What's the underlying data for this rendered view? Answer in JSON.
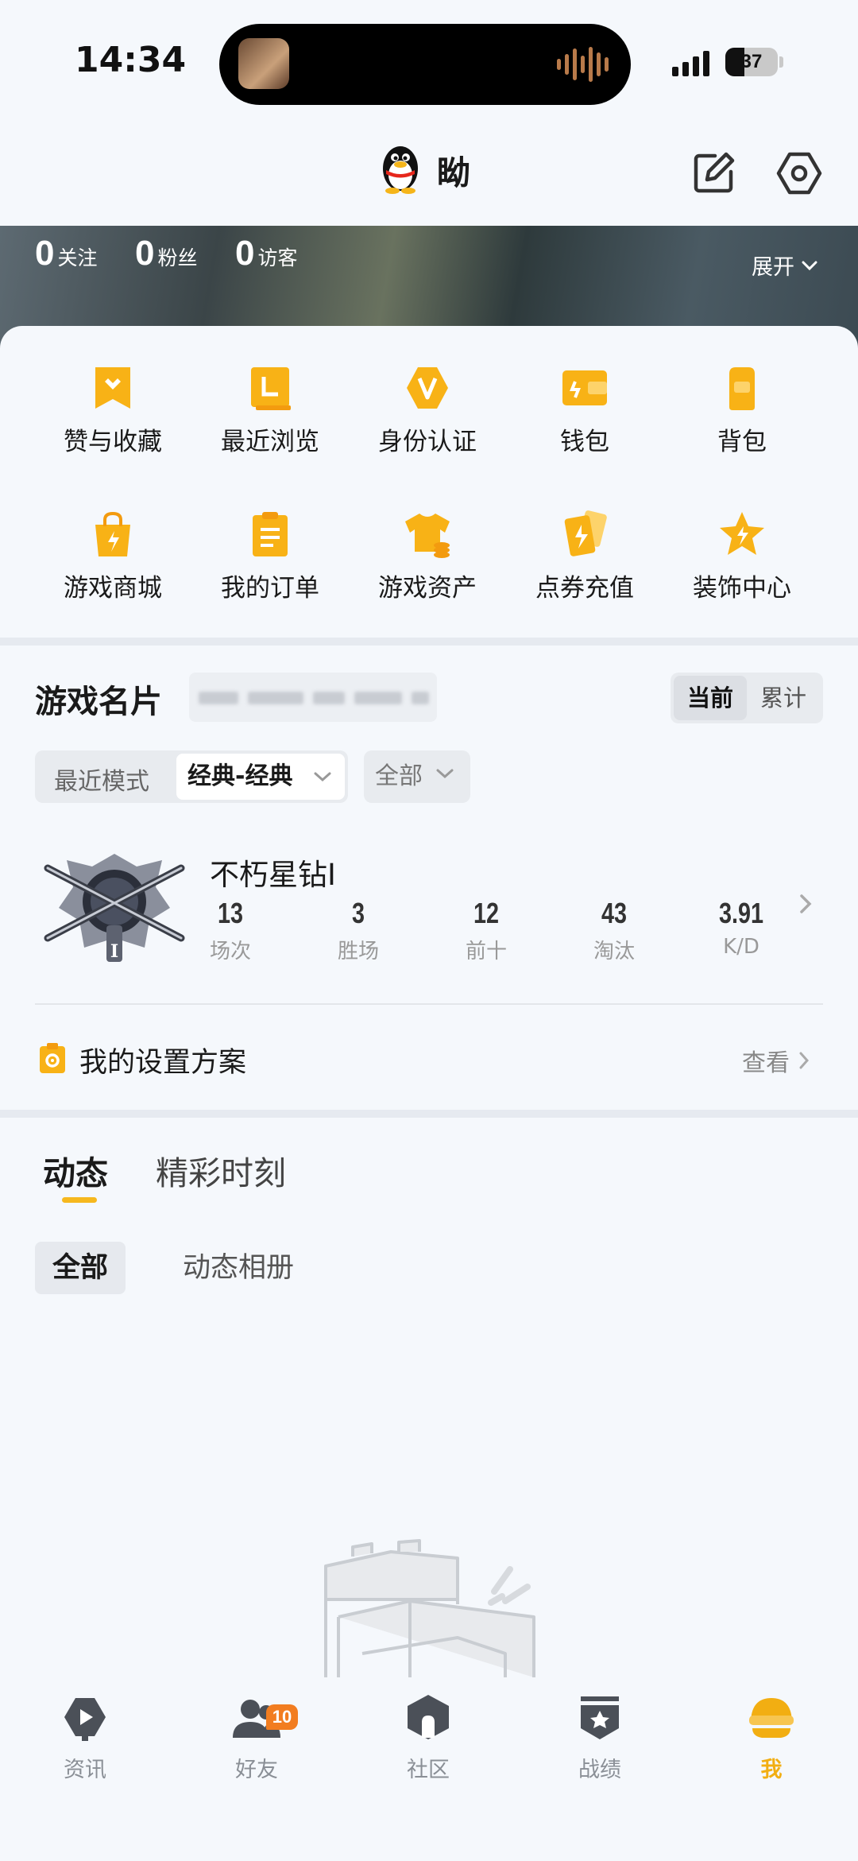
{
  "status_bar": {
    "time": "14:34",
    "battery": "37"
  },
  "header": {
    "username": "眑"
  },
  "stats": [
    {
      "count": "0",
      "label": "关注"
    },
    {
      "count": "0",
      "label": "粉丝"
    },
    {
      "count": "0",
      "label": "访客"
    }
  ],
  "expand_label": "展开",
  "grid": [
    {
      "label": "赞与收藏",
      "icon": "like-collect-icon"
    },
    {
      "label": "最近浏览",
      "icon": "recent-browse-icon"
    },
    {
      "label": "身份认证",
      "icon": "identity-verify-icon"
    },
    {
      "label": "钱包",
      "icon": "wallet-icon"
    },
    {
      "label": "背包",
      "icon": "backpack-icon"
    },
    {
      "label": "游戏商城",
      "icon": "game-store-icon"
    },
    {
      "label": "我的订单",
      "icon": "orders-icon"
    },
    {
      "label": "游戏资产",
      "icon": "game-assets-icon"
    },
    {
      "label": "点券充值",
      "icon": "coupon-recharge-icon"
    },
    {
      "label": "装饰中心",
      "icon": "decoration-center-icon"
    }
  ],
  "game_card": {
    "title": "游戏名片",
    "toggle": [
      "当前",
      "累计"
    ],
    "mode_label": "最近模式",
    "mode_value": "经典-经典",
    "filter_value": "全部",
    "rank_name": "不朽星钻I",
    "stats": [
      {
        "value": "13",
        "label": "场次"
      },
      {
        "value": "3",
        "label": "胜场"
      },
      {
        "value": "12",
        "label": "前十"
      },
      {
        "value": "43",
        "label": "淘汰"
      },
      {
        "value": "3.91",
        "label": "K/D"
      }
    ]
  },
  "settings_row": {
    "label": "我的设置方案",
    "action": "查看"
  },
  "tabs": [
    "动态",
    "精彩时刻"
  ],
  "sub_tabs": [
    "全部",
    "动态相册"
  ],
  "bottom_nav": [
    {
      "label": "资讯",
      "icon": "news-icon"
    },
    {
      "label": "好友",
      "icon": "friends-icon",
      "badge": "10"
    },
    {
      "label": "社区",
      "icon": "community-icon"
    },
    {
      "label": "战绩",
      "icon": "record-icon"
    },
    {
      "label": "我",
      "icon": "me-icon"
    }
  ],
  "colors": {
    "accent": "#f6b81e",
    "active_nav": "#f2ae12",
    "badge": "#f27d20"
  }
}
